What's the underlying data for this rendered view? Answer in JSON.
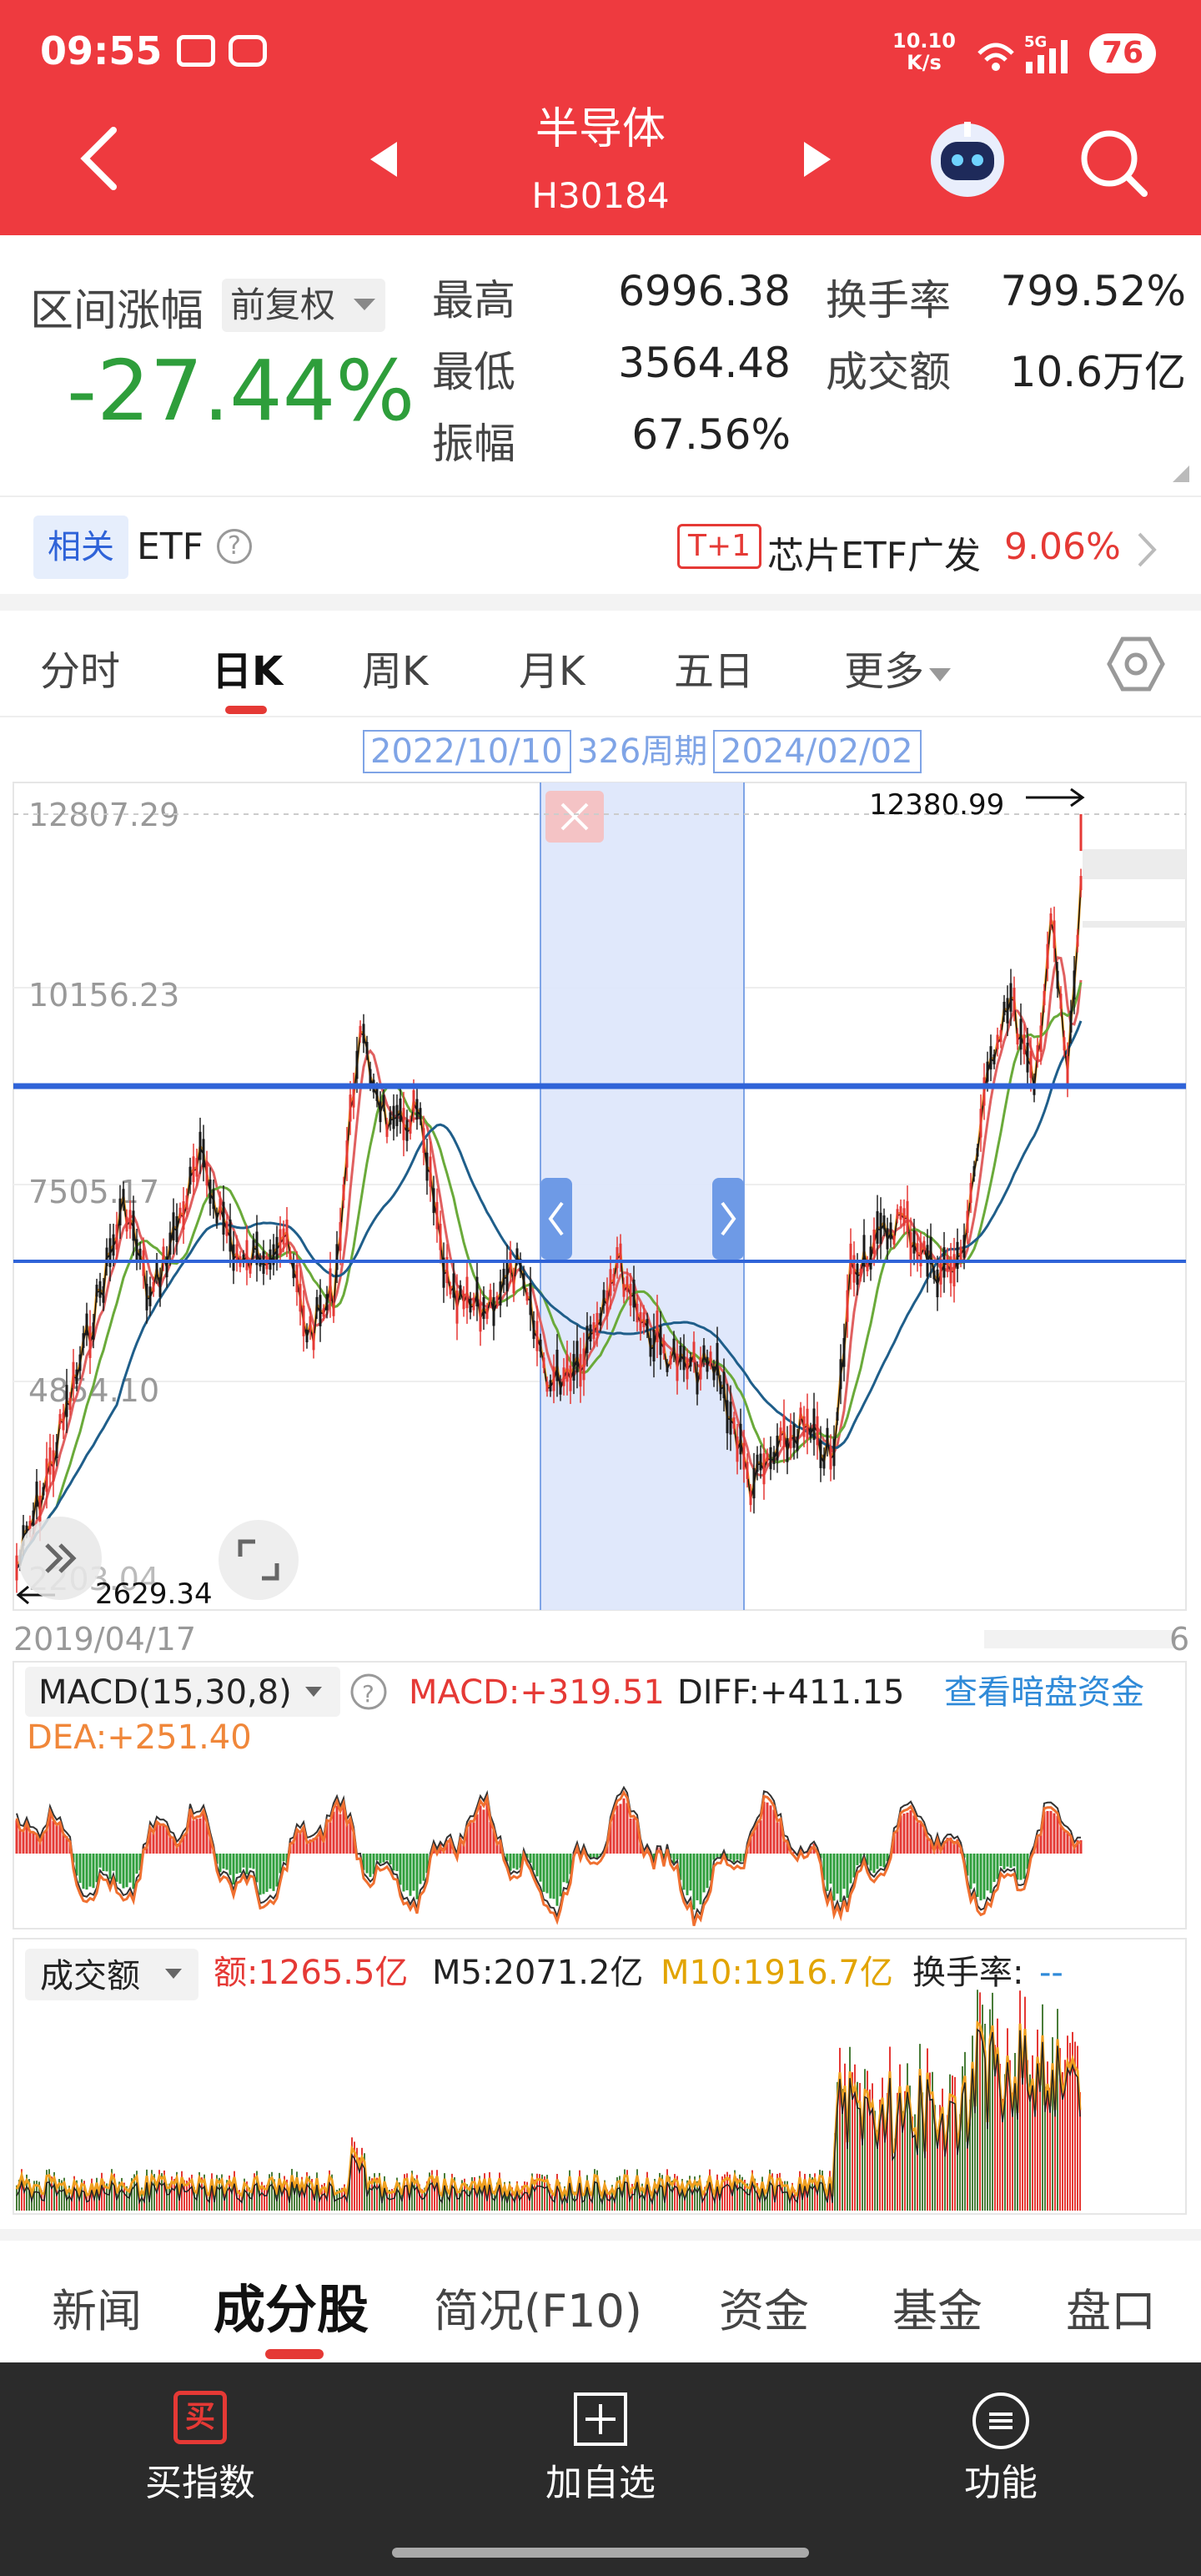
{
  "status": {
    "time": "09:55",
    "net_speed": "10.10",
    "net_unit": "K/s",
    "signal": "5G",
    "battery": "76"
  },
  "header": {
    "title": "半导体",
    "code": "H30184"
  },
  "stats": {
    "range_label": "区间涨幅",
    "adjust": "前复权",
    "range_change": "-27.44%",
    "high_label": "最高",
    "high": "6996.38",
    "low_label": "最低",
    "low": "3564.48",
    "amp_label": "振幅",
    "amp": "67.56%",
    "turnover_label": "换手率",
    "turnover": "799.52%",
    "volume_label": "成交额",
    "volume": "10.6万亿"
  },
  "etf": {
    "related": "相关",
    "etf": "ETF",
    "tag": "T+1",
    "fund_name": "芯片ETF广发",
    "fund_change": "9.06%"
  },
  "tabs": [
    "分时",
    "日K",
    "周K",
    "月K",
    "五日",
    "更多"
  ],
  "interval": {
    "start": "2022/10/10",
    "period": "326周期",
    "end": "2024/02/02"
  },
  "kline": {
    "y_labels": [
      "12807.29",
      "10156.23",
      "7505.17",
      "4854.10",
      "2203.04"
    ],
    "max_label": "12380.99",
    "min_label": "2629.34",
    "start_date": "2019/04/17",
    "end_date_partial": "6"
  },
  "macd": {
    "indicator": "MACD(15,30,8)",
    "macd_label": "MACD:",
    "macd_value": "+319.51",
    "diff": "DIFF:+411.15",
    "dea": "DEA:+251.40",
    "dark_pool": "查看暗盘资金"
  },
  "volume": {
    "indicator": "成交额",
    "amount": "额:1265.5亿",
    "m5": "M5:2071.2亿",
    "m10": "M10:1916.7亿",
    "turnover": "换手率:",
    "turnover_val": "--"
  },
  "bottom_tabs": [
    "新闻",
    "成分股",
    "简况(F10)",
    "资金",
    "基金",
    "盘口"
  ],
  "nav": [
    "买指数",
    "加自选",
    "功能"
  ],
  "nav_icon_char": "买",
  "colors": {
    "brand": "#ee3a3f",
    "down": "#2e9e3b",
    "accent_blue": "#2f63d8"
  }
}
